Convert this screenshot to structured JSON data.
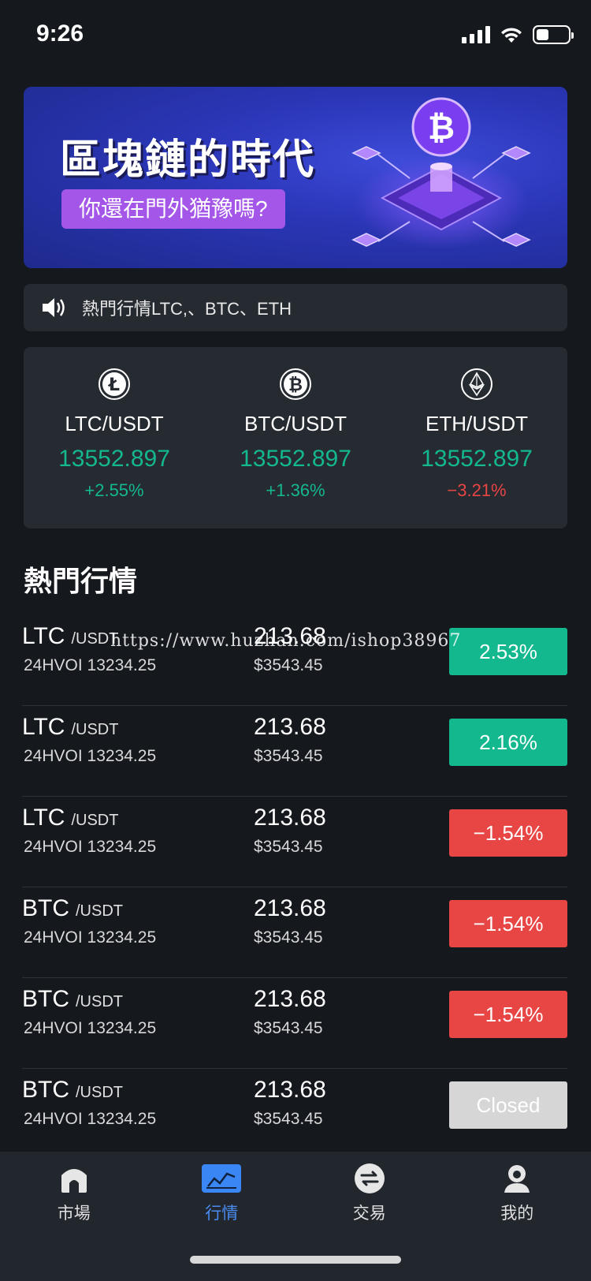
{
  "status_bar": {
    "time": "9:26"
  },
  "banner": {
    "title": "區塊鏈的時代",
    "subtitle": "你還在門外猶豫嗎?"
  },
  "notice": {
    "text": "熱門行情LTC,、BTC、ETH"
  },
  "tickers": [
    {
      "icon": "litecoin-icon",
      "pair": "LTC/USDT",
      "price": "13552.897",
      "change": "+2.55%",
      "direction": "up"
    },
    {
      "icon": "bitcoin-icon",
      "pair": "BTC/USDT",
      "price": "13552.897",
      "change": "+1.36%",
      "direction": "up"
    },
    {
      "icon": "ethereum-icon",
      "pair": "ETH/USDT",
      "price": "13552.897",
      "change": "−3.21%",
      "direction": "down"
    }
  ],
  "section": {
    "title": "熱門行情"
  },
  "market": [
    {
      "coin": "LTC",
      "quote": "/USDT",
      "volume": "24HVOI 13234.25",
      "price": "213.68",
      "usd": "$3543.45",
      "change": "2.53%",
      "state": "up"
    },
    {
      "coin": "LTC",
      "quote": "/USDT",
      "volume": "24HVOI 13234.25",
      "price": "213.68",
      "usd": "$3543.45",
      "change": "2.16%",
      "state": "up"
    },
    {
      "coin": "LTC",
      "quote": "/USDT",
      "volume": "24HVOI 13234.25",
      "price": "213.68",
      "usd": "$3543.45",
      "change": "−1.54%",
      "state": "down"
    },
    {
      "coin": "BTC",
      "quote": "/USDT",
      "volume": "24HVOI 13234.25",
      "price": "213.68",
      "usd": "$3543.45",
      "change": "−1.54%",
      "state": "down"
    },
    {
      "coin": "BTC",
      "quote": "/USDT",
      "volume": "24HVOI 13234.25",
      "price": "213.68",
      "usd": "$3543.45",
      "change": "−1.54%",
      "state": "down"
    },
    {
      "coin": "BTC",
      "quote": "/USDT",
      "volume": "24HVOI 13234.25",
      "price": "213.68",
      "usd": "$3543.45",
      "change": "Closed",
      "state": "closed"
    }
  ],
  "watermark": "https://www.huzhan.com/ishop38967",
  "tabbar": {
    "items": [
      {
        "label": "市場",
        "icon": "home-icon",
        "active": false
      },
      {
        "label": "行情",
        "icon": "chart-icon",
        "active": true
      },
      {
        "label": "交易",
        "icon": "swap-icon",
        "active": false
      },
      {
        "label": "我的",
        "icon": "profile-icon",
        "active": false
      }
    ]
  },
  "colors": {
    "up": "#14b88f",
    "down": "#e84545",
    "active_tab": "#4a8cf2",
    "background": "#15181d",
    "card": "#262a31"
  }
}
